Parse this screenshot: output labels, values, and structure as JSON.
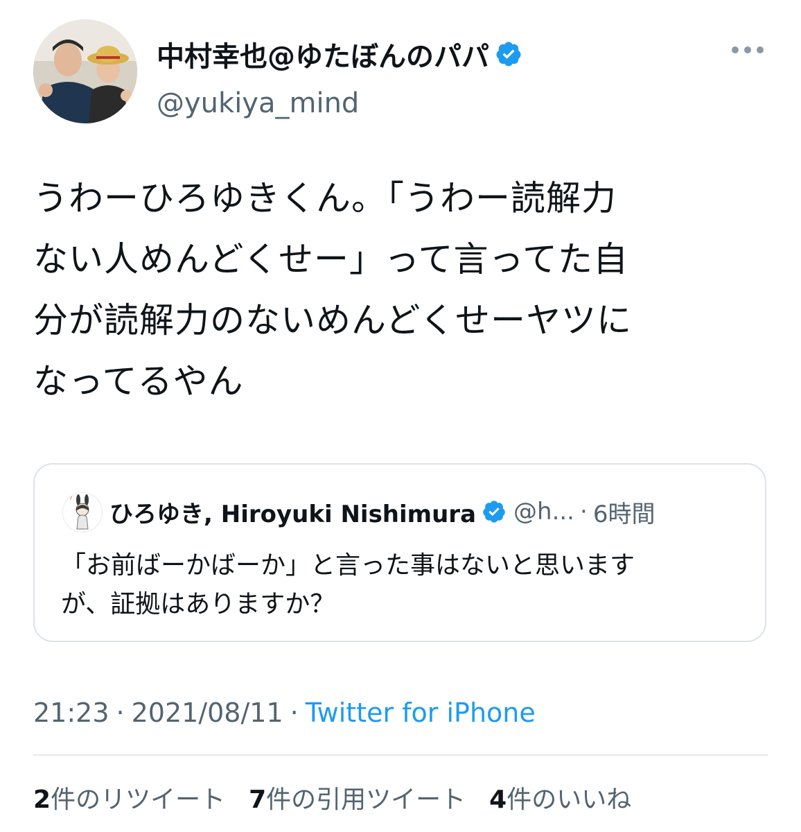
{
  "author": {
    "display_name": "中村幸也@ゆたぼんのパパ",
    "handle": "@yukiya_mind",
    "verified": true,
    "avatar_icon": "profile-photo"
  },
  "more_icon": "more-horizontal-icon",
  "tweet": {
    "text": "うわーひろゆきくん。「うわー読解力\nない人めんどくせー」って言ってた自\n分が読解力のないめんどくせーヤツに\nなってるやん"
  },
  "quoted_tweet": {
    "display_name": "ひろゆき, Hiroyuki Nishimura",
    "handle": "@h...",
    "separator": "·",
    "time": "6時間",
    "verified": true,
    "text": "「お前ばーかばーか」と言った事はないと思います\nが、証拠はありますか？"
  },
  "meta": {
    "time": "21:23",
    "separator": "·",
    "date": "2021/08/11",
    "source": "Twitter for iPhone"
  },
  "stats": {
    "retweets": {
      "count": "2",
      "label": "件のリツイート"
    },
    "quotes": {
      "count": "7",
      "label": "件の引用ツイート"
    },
    "likes": {
      "count": "4",
      "label": "件のいいね"
    }
  },
  "colors": {
    "text": "#0f1419",
    "secondary": "#536471",
    "link": "#1d9bf0",
    "verified": "#1d9bf0",
    "border": "#dde2e6"
  }
}
